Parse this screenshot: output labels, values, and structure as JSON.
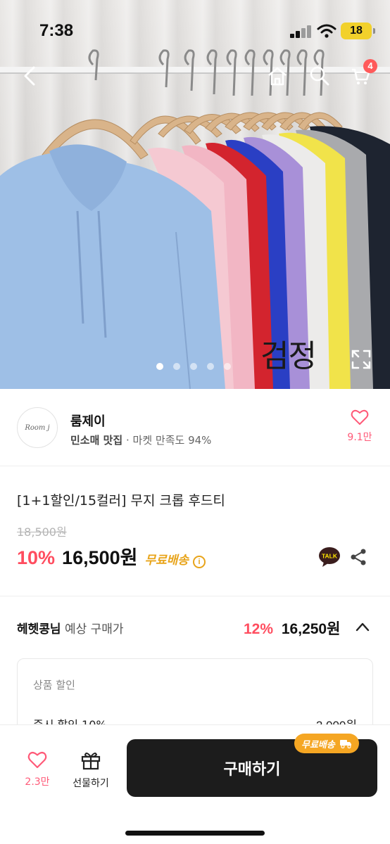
{
  "status": {
    "time": "7:38",
    "battery": "18"
  },
  "nav": {
    "cart_count": "4"
  },
  "hero": {
    "color_label": "검정",
    "slides": 5,
    "active_slide": 1
  },
  "seller": {
    "name": "룸제이",
    "badge": "민소매 맛집",
    "satisfaction": "· 마켓 만족도 94%",
    "likes": "9.1만",
    "logo_text": "Room j"
  },
  "product": {
    "title": "[1+1할인/15컬러] 무지 크롭 후드티",
    "original_price": "18,500원",
    "discount": "10%",
    "price": "16,500원",
    "shipping": "무료배송",
    "talk_label": "TALK"
  },
  "member": {
    "name": "헤헷콩님",
    "label": "예상 구매가",
    "discount": "12%",
    "price": "16,250원"
  },
  "discount_box": {
    "heading": "상품 할인",
    "row_label": "즉시 할인 10%",
    "row_value": "-2,000원"
  },
  "bottom": {
    "likes": "2.3만",
    "gift_label": "선물하기",
    "buy_label": "구매하기",
    "shipping_badge": "무료배송"
  },
  "colors": {
    "accent_red": "#ff4d5f",
    "like_pink": "#ff5a78",
    "shipping_orange": "#e8a41a",
    "buy_button": "#1c1c1c"
  }
}
